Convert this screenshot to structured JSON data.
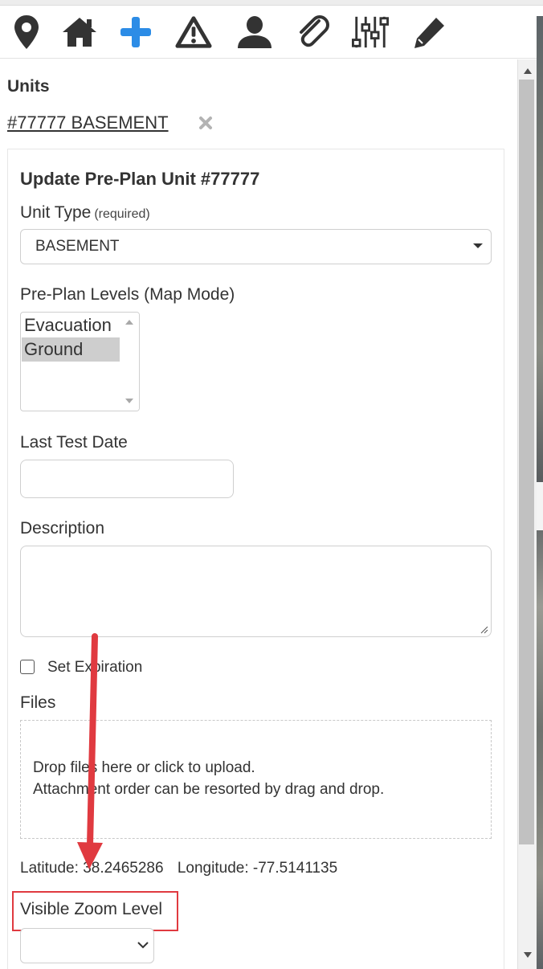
{
  "toolbar": {
    "icons": [
      "map-marker-icon",
      "home-icon",
      "plus-icon",
      "warning-icon",
      "user-icon",
      "paperclip-icon",
      "sliders-icon",
      "pencil-icon"
    ],
    "accent_color": "#2c8ce6",
    "icon_color": "#333333"
  },
  "units": {
    "heading": "Units",
    "selected_unit": "#77777 BASEMENT"
  },
  "form": {
    "title": "Update Pre-Plan Unit #77777",
    "unit_type_label": "Unit Type",
    "unit_type_hint": "(required)",
    "unit_type_value": "BASEMENT",
    "levels_label": "Pre-Plan Levels (Map Mode)",
    "levels_options": [
      "Evacuation",
      "Ground"
    ],
    "levels_selected": "Ground",
    "last_test_label": "Last Test Date",
    "last_test_value": "",
    "description_label": "Description",
    "description_value": "",
    "set_expiration_label": "Set Expiration",
    "set_expiration_checked": false,
    "files_label": "Files",
    "dropzone_line1": "Drop files here or click to upload.",
    "dropzone_line2": "Attachment order can be resorted by drag and drop.",
    "latitude_label": "Latitude:",
    "latitude_value": "38.2465286",
    "longitude_label": "Longitude:",
    "longitude_value": "-77.5141135",
    "zoom_label": "Visible Zoom Level",
    "zoom_value": ""
  },
  "annotation": {
    "color": "#e03a40"
  }
}
